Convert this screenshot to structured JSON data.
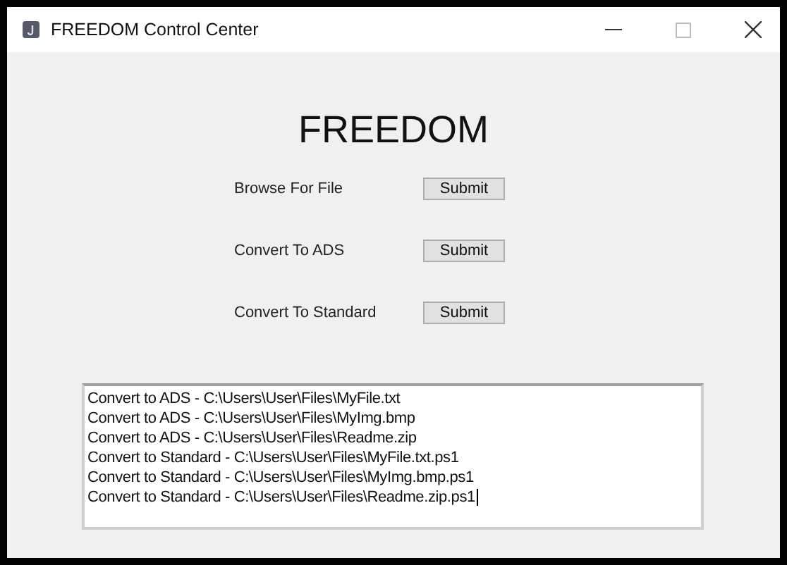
{
  "window": {
    "title": "FREEDOM Control Center"
  },
  "heading": "FREEDOM",
  "actions": [
    {
      "label": "Browse For File",
      "button": "Submit"
    },
    {
      "label": "Convert To ADS",
      "button": "Submit"
    },
    {
      "label": "Convert To Standard",
      "button": "Submit"
    }
  ],
  "log": [
    "Convert to ADS - C:\\Users\\User\\Files\\MyFile.txt",
    "Convert to ADS - C:\\Users\\User\\Files\\MyImg.bmp",
    "Convert to ADS - C:\\Users\\User\\Files\\Readme.zip",
    "Convert to Standard - C:\\Users\\User\\Files\\MyFile.txt.ps1",
    "Convert to Standard - C:\\Users\\User\\Files\\MyImg.bmp.ps1",
    "Convert to Standard - C:\\Users\\User\\Files\\Readme.zip.ps1"
  ]
}
